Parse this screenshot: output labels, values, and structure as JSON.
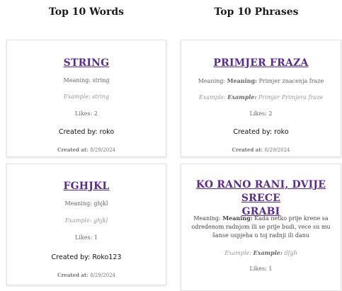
{
  "headers": {
    "words": "Top 10 Words",
    "phrases": "Top 10 Phrases"
  },
  "words": [
    {
      "title": "STRING",
      "meaning_label": "Meaning:",
      "meaning": "string",
      "example_label": "Example:",
      "example": "string",
      "likes_label": "Likes:",
      "likes": "2",
      "created_by_label": "Created by:",
      "created_by": "roko",
      "created_at_label": "Created at:",
      "created_at": "8/29/2024"
    },
    {
      "title": "FGHJKL",
      "meaning_label": "Meaning:",
      "meaning": "ghjkl",
      "example_label": "Example:",
      "example": "ghjkl",
      "likes_label": "Likes:",
      "likes": "1",
      "created_by_label": "Created by:",
      "created_by": "Roko123",
      "created_at_label": "Created at:",
      "created_at": "8/29/2024"
    }
  ],
  "phrases": [
    {
      "title": "PRIMJER FRAZA",
      "meaning_label": "Meaning:",
      "meaning_bold": "Meaning:",
      "meaning": "Primjer znacenja fraze",
      "example_label": "Example:",
      "example_bold": "Example:",
      "example": "Primjer Primjera fraze",
      "likes_label": "Likes:",
      "likes": "2",
      "created_by_label": "Created by:",
      "created_by": "roko",
      "created_at_label": "Created at:",
      "created_at": "8/29/2024"
    },
    {
      "title_line1": "KO RANO RANI, DVIJE SRECE",
      "title_line2": "GRABI",
      "meaning_label": "Meaning:",
      "meaning_bold": "Meaning:",
      "meaning_line1": "Kada netko prije krene sa",
      "meaning_line2": "odredenom radnjom ili se prije budi, vece su mu",
      "meaning_line3": "šanse uspjeha u toj radnji ili danu",
      "example_label": "Example:",
      "example_bold": "Example:",
      "example": "dfgh",
      "likes_label": "Likes:",
      "likes": "1"
    }
  ]
}
